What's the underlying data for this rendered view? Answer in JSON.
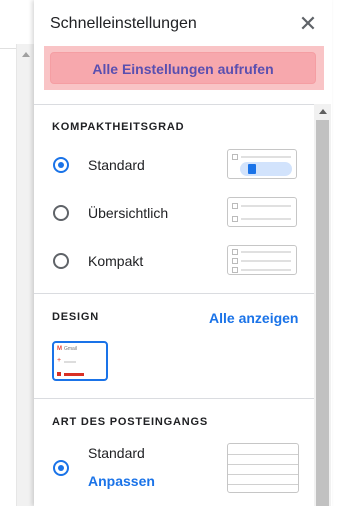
{
  "panel": {
    "title": "Schnelleinstellungen",
    "all_settings_label": "Alle Einstellungen aufrufen"
  },
  "density": {
    "heading": "KOMPAKTHEITSGRAD",
    "options": [
      {
        "label": "Standard",
        "selected": true
      },
      {
        "label": "Übersichtlich",
        "selected": false
      },
      {
        "label": "Kompakt",
        "selected": false
      }
    ]
  },
  "theme": {
    "heading": "DESIGN",
    "show_all_label": "Alle anzeigen",
    "thumb_text": "Gmail"
  },
  "inbox_type": {
    "heading": "ART DES POSTEINGANGS",
    "option_label": "Standard",
    "customize_label": "Anpassen",
    "selected": true
  },
  "colors": {
    "accent": "#1a73e8",
    "highlight": "#f9c4c6"
  },
  "icons": {
    "close": "close-icon",
    "radio": "radio-icon"
  }
}
